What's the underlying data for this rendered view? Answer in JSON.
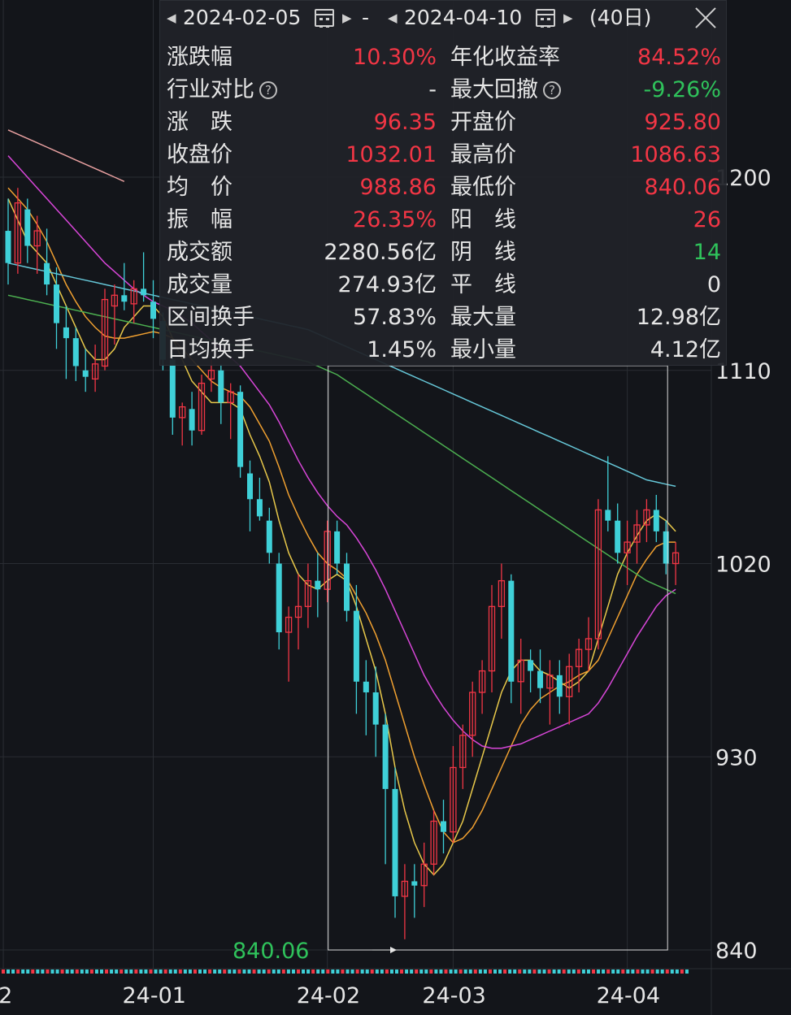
{
  "colors": {
    "up": "#f23645",
    "down": "#3fd0d8",
    "ma5": "#e8c84a",
    "ma10": "#f0a030",
    "ma20": "#d846d8",
    "ma60": "#4caf50",
    "ma120": "#66c7d8",
    "ma250": "#e8a0a0",
    "grid": "#2a2d33",
    "background": "#13151a"
  },
  "panel": {
    "start_date": "2024-02-05",
    "end_date": "2024-04-10",
    "separator": "-",
    "days": "(40日)",
    "icons": [
      "prev-arrow-icon",
      "calendar-icon",
      "next-arrow-icon",
      "close-icon"
    ],
    "rows": [
      {
        "left_label": "涨跌幅",
        "left_value": "10.30%",
        "left_color": "red",
        "right_label": "年化收益率",
        "right_value": "84.52%",
        "right_color": "red"
      },
      {
        "left_label": "行业对比",
        "left_help": true,
        "left_value": "-",
        "left_color": "white",
        "right_label": "最大回撤",
        "right_help": true,
        "right_value": "-9.26%",
        "right_color": "green"
      },
      {
        "left_label": "涨　跌",
        "left_value": "96.35",
        "left_color": "red",
        "right_label": "开盘价",
        "right_value": "925.80",
        "right_color": "red"
      },
      {
        "left_label": "收盘价",
        "left_value": "1032.01",
        "left_color": "red",
        "right_label": "最高价",
        "right_value": "1086.63",
        "right_color": "red"
      },
      {
        "left_label": "均　价",
        "left_value": "988.86",
        "left_color": "red",
        "right_label": "最低价",
        "right_value": "840.06",
        "right_color": "red"
      },
      {
        "left_label": "振　幅",
        "left_value": "26.35%",
        "left_color": "red",
        "right_label": "阳　线",
        "right_value": "26",
        "right_color": "red"
      },
      {
        "left_label": "成交额",
        "left_value": "2280.56亿",
        "left_color": "white",
        "right_label": "阴　线",
        "right_value": "14",
        "right_color": "green"
      },
      {
        "left_label": "成交量",
        "left_value": "274.93亿",
        "left_color": "white",
        "right_label": "平　线",
        "right_value": "0",
        "right_color": "white"
      },
      {
        "left_label": "区间换手",
        "left_value": "57.83%",
        "left_color": "white",
        "right_label": "最大量",
        "right_value": "12.98亿",
        "right_color": "white"
      },
      {
        "left_label": "日均换手",
        "left_value": "1.45%",
        "left_color": "white",
        "right_label": "最小量",
        "right_value": "4.12亿",
        "right_color": "white"
      }
    ]
  },
  "chart_data": {
    "type": "candlestick",
    "y_ticks": [
      {
        "value": 1200,
        "label": "1200"
      },
      {
        "value": 1110,
        "label": "1110"
      },
      {
        "value": 1020,
        "label": "1020"
      },
      {
        "value": 930,
        "label": "930"
      },
      {
        "value": 840,
        "label": "840"
      }
    ],
    "x_ticks": [
      {
        "label": "2",
        "index": -0.5
      },
      {
        "label": "24-01",
        "index": 15
      },
      {
        "label": "24-02",
        "index": 33
      },
      {
        "label": "24-03",
        "index": 46
      },
      {
        "label": "24-04",
        "index": 64
      }
    ],
    "ylim": [
      840,
      1200
    ],
    "min_label": "840.06",
    "selection": {
      "start_index": 33,
      "end_index": 68
    },
    "candles": [
      [
        1175,
        1190,
        1150,
        1160
      ],
      [
        1160,
        1195,
        1155,
        1188
      ],
      [
        1185,
        1190,
        1160,
        1168
      ],
      [
        1168,
        1182,
        1155,
        1175
      ],
      [
        1160,
        1176,
        1145,
        1150
      ],
      [
        1150,
        1158,
        1120,
        1132
      ],
      [
        1130,
        1140,
        1106,
        1125
      ],
      [
        1125,
        1130,
        1105,
        1112
      ],
      [
        1110,
        1120,
        1100,
        1107
      ],
      [
        1106,
        1122,
        1100,
        1113
      ],
      [
        1112,
        1148,
        1110,
        1143
      ],
      [
        1140,
        1150,
        1122,
        1145
      ],
      [
        1145,
        1160,
        1138,
        1142
      ],
      [
        1141,
        1152,
        1132,
        1148
      ],
      [
        1148,
        1165,
        1142,
        1145
      ],
      [
        1142,
        1152,
        1125,
        1134
      ],
      [
        1133,
        1137,
        1110,
        1115
      ],
      [
        1115,
        1118,
        1080,
        1088
      ],
      [
        1088,
        1095,
        1075,
        1093
      ],
      [
        1092,
        1100,
        1075,
        1082
      ],
      [
        1082,
        1108,
        1080,
        1104
      ],
      [
        1106,
        1115,
        1100,
        1110
      ],
      [
        1110,
        1113,
        1085,
        1095
      ],
      [
        1095,
        1104,
        1078,
        1100
      ],
      [
        1100,
        1103,
        1060,
        1065
      ],
      [
        1062,
        1068,
        1035,
        1050
      ],
      [
        1050,
        1060,
        1040,
        1042
      ],
      [
        1040,
        1046,
        1020,
        1025
      ],
      [
        1020,
        1025,
        980,
        988
      ],
      [
        988,
        1000,
        965,
        995
      ],
      [
        995,
        1015,
        980,
        1000
      ],
      [
        1000,
        1020,
        990,
        1012
      ],
      [
        1012,
        1025,
        995,
        1008
      ],
      [
        1008,
        1040,
        1002,
        1035
      ],
      [
        1035,
        1040,
        1015,
        1020
      ],
      [
        1020,
        1025,
        993,
        998
      ],
      [
        998,
        1010,
        950,
        965
      ],
      [
        965,
        975,
        940,
        960
      ],
      [
        960,
        972,
        930,
        945
      ],
      [
        945,
        950,
        880,
        915
      ],
      [
        915,
        925,
        855,
        865
      ],
      [
        865,
        880,
        845,
        872
      ],
      [
        872,
        880,
        855,
        870
      ],
      [
        870,
        890,
        860,
        880
      ],
      [
        880,
        905,
        875,
        900
      ],
      [
        900,
        910,
        885,
        895
      ],
      [
        895,
        935,
        890,
        925
      ],
      [
        925,
        945,
        915,
        940
      ],
      [
        940,
        965,
        930,
        960
      ],
      [
        960,
        975,
        950,
        970
      ],
      [
        970,
        1010,
        960,
        1000
      ],
      [
        1000,
        1020,
        985,
        1012
      ],
      [
        1012,
        1015,
        955,
        965
      ],
      [
        965,
        985,
        950,
        975
      ],
      [
        975,
        980,
        960,
        970
      ],
      [
        970,
        980,
        955,
        962
      ],
      [
        962,
        975,
        945,
        968
      ],
      [
        968,
        975,
        950,
        958
      ],
      [
        958,
        978,
        945,
        972
      ],
      [
        972,
        985,
        960,
        980
      ],
      [
        980,
        995,
        970,
        985
      ],
      [
        985,
        1050,
        980,
        1045
      ],
      [
        1045,
        1070,
        1035,
        1040
      ],
      [
        1040,
        1048,
        1020,
        1025
      ],
      [
        1025,
        1040,
        1010,
        1030
      ],
      [
        1030,
        1045,
        1020,
        1038
      ],
      [
        1038,
        1050,
        1030,
        1045
      ],
      [
        1045,
        1052,
        1030,
        1035
      ],
      [
        1035,
        1040,
        1015,
        1020
      ],
      [
        1020,
        1030,
        1010,
        1025
      ]
    ],
    "ma_series": [
      {
        "key": "ma5",
        "values": [
          1190,
          1180,
          1170,
          1165,
          1160,
          1150,
          1140,
          1130,
          1120,
          1115,
          1115,
          1120,
          1130,
          1135,
          1140,
          1140,
          1135,
          1125,
          1115,
          1105,
          1100,
          1095,
          1095,
          1095,
          1092,
          1080,
          1070,
          1058,
          1040,
          1025,
          1015,
          1010,
          1008,
          1012,
          1015,
          1012,
          1000,
          985,
          970,
          950,
          925,
          905,
          890,
          880,
          875,
          880,
          890,
          900,
          915,
          930,
          945,
          960,
          970,
          975,
          975,
          970,
          968,
          965,
          962,
          965,
          970,
          985,
          1000,
          1015,
          1025,
          1033,
          1040,
          1043,
          1040,
          1035
        ]
      },
      {
        "key": "ma10",
        "values": [
          1195,
          1190,
          1185,
          1178,
          1170,
          1160,
          1150,
          1142,
          1135,
          1130,
          1126,
          1125,
          1125,
          1126,
          1127,
          1128,
          1127,
          1125,
          1120,
          1115,
          1110,
          1105,
          1102,
          1100,
          1098,
          1093,
          1085,
          1077,
          1065,
          1052,
          1042,
          1033,
          1025,
          1020,
          1017,
          1013,
          1005,
          997,
          987,
          975,
          960,
          945,
          930,
          917,
          905,
          895,
          890,
          892,
          897,
          905,
          915,
          925,
          935,
          945,
          952,
          957,
          960,
          963,
          965,
          968,
          970,
          975,
          985,
          995,
          1005,
          1015,
          1022,
          1028,
          1030,
          1030
        ]
      },
      {
        "key": "ma20",
        "values": [
          1210,
          1205,
          1200,
          1195,
          1190,
          1185,
          1180,
          1175,
          1170,
          1165,
          1160,
          1156,
          1152,
          1148,
          1145,
          1142,
          1140,
          1138,
          1135,
          1132,
          1128,
          1124,
          1120,
          1116,
          1112,
          1106,
          1100,
          1094,
          1086,
          1077,
          1068,
          1060,
          1053,
          1047,
          1042,
          1038,
          1032,
          1025,
          1017,
          1008,
          998,
          988,
          978,
          968,
          960,
          953,
          947,
          942,
          938,
          935,
          934,
          934,
          935,
          936,
          938,
          940,
          942,
          944,
          946,
          948,
          950,
          955,
          962,
          970,
          978,
          986,
          993,
          1000,
          1005,
          1008
        ]
      },
      {
        "key": "ma60",
        "values": [
          1145,
          1144,
          1143,
          1142,
          1141,
          1140,
          1139,
          1138,
          1137,
          1136,
          1135,
          1134,
          1133,
          1132,
          1131,
          1130,
          1129,
          1128,
          1127,
          1126,
          1125,
          1124,
          1123,
          1122,
          1121,
          1120,
          1119,
          1118,
          1117,
          1116,
          1115,
          1114,
          1112,
          1110,
          1108,
          1105,
          1102,
          1099,
          1096,
          1093,
          1090,
          1087,
          1084,
          1081,
          1078,
          1075,
          1072,
          1069,
          1066,
          1063,
          1060,
          1057,
          1054,
          1051,
          1048,
          1045,
          1042,
          1039,
          1036,
          1033,
          1030,
          1027,
          1024,
          1021,
          1018,
          1015,
          1012,
          1010,
          1008,
          1006
        ]
      },
      {
        "key": "ma120",
        "values": [
          1160,
          1159,
          1158,
          1157,
          1156,
          1155,
          1154,
          1153,
          1152,
          1151,
          1150,
          1149,
          1148,
          1147,
          1146,
          1145,
          1144,
          1143,
          1142,
          1141,
          1140,
          1139,
          1138,
          1137,
          1136,
          1135,
          1134,
          1133,
          1132,
          1131,
          1130,
          1129,
          1127,
          1125,
          1123,
          1121,
          1119,
          1117,
          1115,
          1113,
          1111,
          1109,
          1107,
          1105,
          1103,
          1101,
          1099,
          1097,
          1095,
          1093,
          1091,
          1089,
          1087,
          1085,
          1083,
          1081,
          1079,
          1077,
          1075,
          1073,
          1071,
          1069,
          1067,
          1065,
          1063,
          1061,
          1059,
          1058,
          1057,
          1056
        ]
      },
      {
        "key": "ma250",
        "values": [
          1222,
          1220,
          1218,
          1216,
          1214,
          1212,
          1210,
          1208,
          1206,
          1204,
          1202,
          1200,
          1198
        ]
      }
    ],
    "volume_strip": "up/down colored volume bars at bottom edge"
  }
}
